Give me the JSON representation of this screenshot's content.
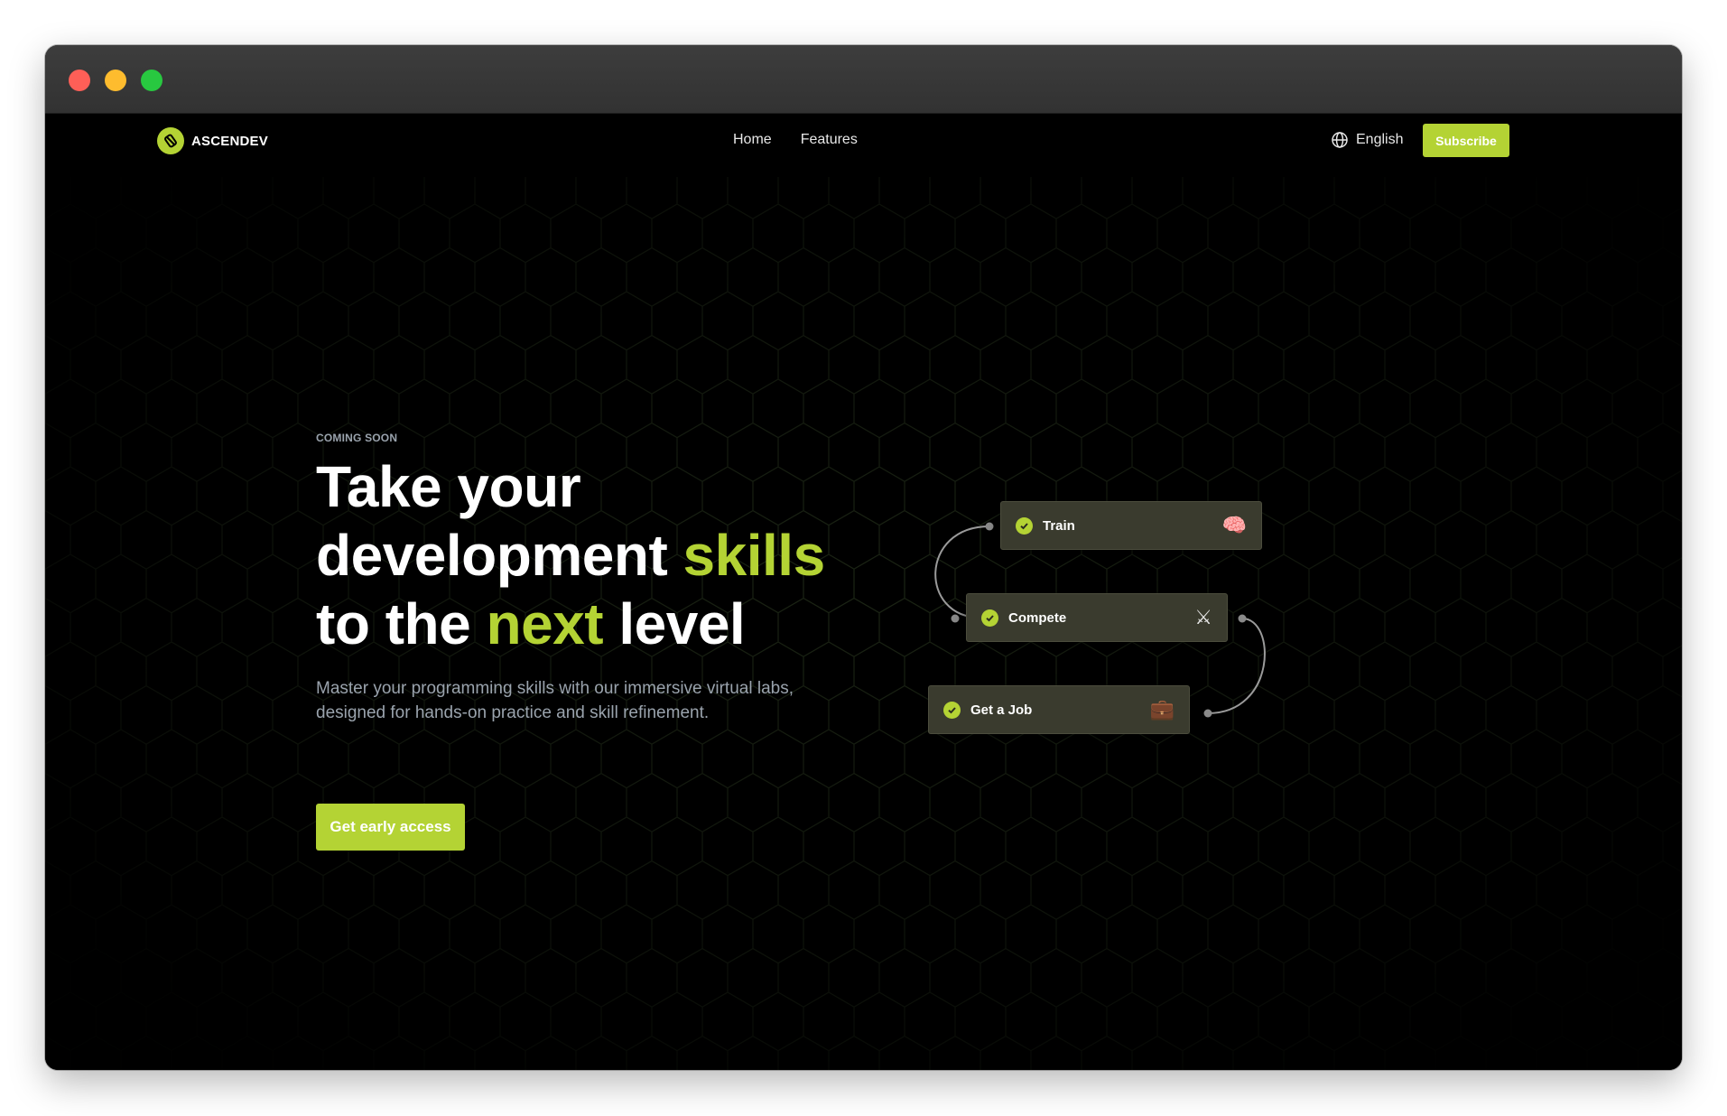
{
  "brand": {
    "name": "ASCENDEV",
    "accent_color": "#b4d334"
  },
  "nav": {
    "links": [
      {
        "label": "Home"
      },
      {
        "label": "Features"
      }
    ],
    "language": {
      "label": "English",
      "icon": "globe-icon"
    },
    "subscribe_label": "Subscribe"
  },
  "hero": {
    "eyebrow": "COMING SOON",
    "headline": {
      "line1": "Take your",
      "line2_prefix": "development ",
      "line2_accent": "skills",
      "line3_prefix": "to the ",
      "line3_accent": "next",
      "line3_suffix": " level"
    },
    "subtext": "Master your programming skills with our immersive virtual labs, designed for hands-on practice and skill refinement.",
    "cta_label": "Get early access"
  },
  "flow": {
    "steps": [
      {
        "label": "Train",
        "icon": "brain-icon",
        "emoji": "🧠"
      },
      {
        "label": "Compete",
        "icon": "crossed-swords-icon",
        "emoji": "⚔"
      },
      {
        "label": "Get a Job",
        "icon": "briefcase-icon",
        "emoji": "💼"
      }
    ]
  }
}
